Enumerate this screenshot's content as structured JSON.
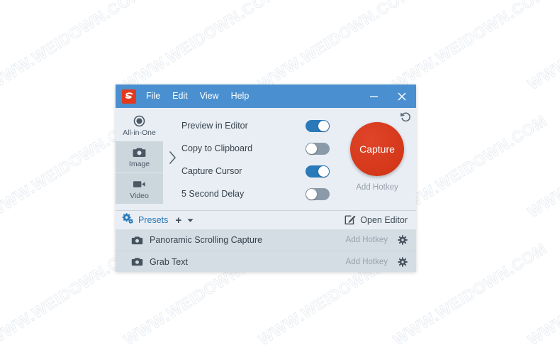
{
  "watermark": {
    "text": "WWW.WEIDOWN.COM",
    "color": "#a8bdd0"
  },
  "window": {
    "title_logo": "snagit-logo-icon",
    "menu": [
      {
        "label": "File"
      },
      {
        "label": "Edit"
      },
      {
        "label": "View"
      },
      {
        "label": "Help"
      }
    ],
    "controls": {
      "minimize": "minimize-icon",
      "close": "close-icon"
    },
    "titlebar_color": "#4a90d0"
  },
  "sidebar": {
    "items": [
      {
        "label": "All-in-One",
        "icon": "all-in-one-icon",
        "selected": false
      },
      {
        "label": "Image",
        "icon": "camera-icon",
        "selected": true
      },
      {
        "label": "Video",
        "icon": "video-camera-icon",
        "selected": true
      }
    ]
  },
  "chevron": {
    "icon": "chevron-right-icon"
  },
  "options": [
    {
      "label": "Preview in Editor",
      "state": "on"
    },
    {
      "label": "Copy to Clipboard",
      "state": "off"
    },
    {
      "label": "Capture Cursor",
      "state": "on"
    },
    {
      "label": "5 Second Delay",
      "state": "off"
    }
  ],
  "capture": {
    "button_label": "Capture",
    "hotkey_label": "Add Hotkey",
    "reset_icon": "undo-arrow-icon",
    "button_color": "#d93a22"
  },
  "presets_bar": {
    "gear_icon": "gears-icon",
    "label": "Presets",
    "plus": "+",
    "caret_icon": "caret-down-icon",
    "open_editor_label": "Open Editor",
    "open_editor_icon": "edit-pencil-icon",
    "accent_color": "#2a79b8"
  },
  "presets": [
    {
      "icon": "camera-icon",
      "name": "Panoramic Scrolling Capture",
      "hotkey": "Add Hotkey",
      "gear": "gear-icon"
    },
    {
      "icon": "camera-icon",
      "name": "Grab Text",
      "hotkey": "Add Hotkey",
      "gear": "gear-icon"
    }
  ]
}
